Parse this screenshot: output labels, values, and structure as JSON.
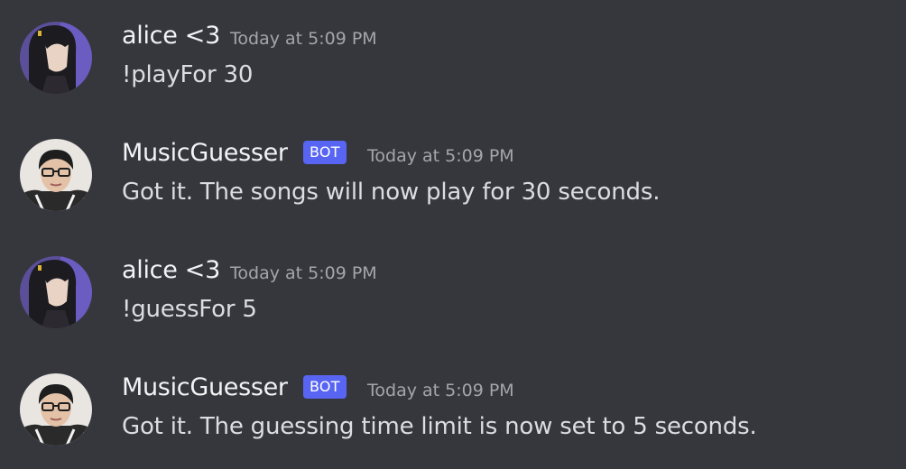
{
  "messages": [
    {
      "author": "alice <3",
      "is_bot": false,
      "timestamp": "Today at 5:09 PM",
      "content": "!playFor 30",
      "avatar_icon": "anime-girl-avatar-icon"
    },
    {
      "author": "MusicGuesser",
      "is_bot": true,
      "bot_tag": "BOT",
      "timestamp": "Today at 5:09 PM",
      "content": "Got it. The songs will now play for 30 seconds.",
      "avatar_icon": "person-with-glasses-avatar-icon"
    },
    {
      "author": "alice <3",
      "is_bot": false,
      "timestamp": "Today at 5:09 PM",
      "content": "!guessFor 5",
      "avatar_icon": "anime-girl-avatar-icon"
    },
    {
      "author": "MusicGuesser",
      "is_bot": true,
      "bot_tag": "BOT",
      "timestamp": "Today at 5:09 PM",
      "content": "Got it. The guessing time limit is now set to 5 seconds.",
      "avatar_icon": "person-with-glasses-avatar-icon"
    }
  ],
  "colors": {
    "background": "#36373d",
    "bot_tag": "#5865f2",
    "username": "#f2f3f5",
    "timestamp": "#a3a6aa",
    "message_text": "#dbdee1"
  }
}
